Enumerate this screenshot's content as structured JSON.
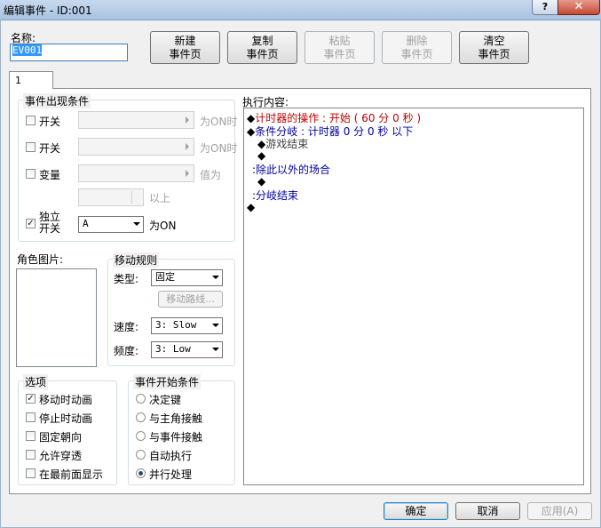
{
  "window": {
    "title": "编辑事件 - ID:001",
    "help": "?",
    "close": "✕"
  },
  "name": {
    "label": "名称:",
    "value": "EV001"
  },
  "toolbar": [
    {
      "l1": "新建",
      "l2": "事件页",
      "enabled": true
    },
    {
      "l1": "复制",
      "l2": "事件页",
      "enabled": true
    },
    {
      "l1": "粘贴",
      "l2": "事件页",
      "enabled": false
    },
    {
      "l1": "删除",
      "l2": "事件页",
      "enabled": false
    },
    {
      "l1": "清空",
      "l2": "事件页",
      "enabled": true
    }
  ],
  "tabs": [
    "1"
  ],
  "conditions": {
    "title": "事件出现条件",
    "switch1": {
      "label": "开关",
      "suffix": "为ON时"
    },
    "switch2": {
      "label": "开关",
      "suffix": "为ON时"
    },
    "variable": {
      "label": "变量",
      "suffix": "值为"
    },
    "above": "以上",
    "self_switch": {
      "label1": "独立",
      "label2": "开关",
      "value": "A",
      "suffix": "为ON",
      "checked": true
    }
  },
  "character_image": {
    "label": "角色图片:"
  },
  "movement": {
    "title": "移动规则",
    "type_label": "类型:",
    "type_value": "固定",
    "route_button": "移动路线...",
    "speed_label": "速度:",
    "speed_value": "3: Slow",
    "freq_label": "频度:",
    "freq_value": "3: Low"
  },
  "options": {
    "title": "选项",
    "items": [
      {
        "label": "移动时动画",
        "checked": true
      },
      {
        "label": "停止时动画",
        "checked": false
      },
      {
        "label": "固定朝向",
        "checked": false
      },
      {
        "label": "允许穿透",
        "checked": false
      },
      {
        "label": "在最前面显示",
        "checked": false
      }
    ]
  },
  "trigger": {
    "title": "事件开始条件",
    "items": [
      {
        "label": "决定键",
        "selected": false
      },
      {
        "label": "与主角接触",
        "selected": false
      },
      {
        "label": "与事件接触",
        "selected": false
      },
      {
        "label": "自动执行",
        "selected": false
      },
      {
        "label": "并行处理",
        "selected": true
      }
    ]
  },
  "contents": {
    "label": "执行内容:",
    "lines": [
      {
        "marker": "◆",
        "text": "计时器的操作 : 开始 ( 60 分 0 秒 )",
        "color": "#c00000"
      },
      {
        "marker": "◆",
        "text": "条件分岐 : 计时器 0 分 0 秒 以下",
        "color": "#0000a0"
      },
      {
        "marker": "◆",
        "text": "游戏结束",
        "color": "#404040"
      },
      {
        "marker": "◆",
        "text": "",
        "color": "#000000"
      },
      {
        "marker": ":",
        "text": "除此以外的场合",
        "color": "#0000a0"
      },
      {
        "marker": "◆",
        "text": "",
        "color": "#000000"
      },
      {
        "marker": ":",
        "text": "分岐结束",
        "color": "#0000a0"
      },
      {
        "marker": "◆",
        "text": "",
        "color": "#000000"
      }
    ]
  },
  "footer": {
    "ok": "确定",
    "cancel": "取消",
    "apply": "应用(A)"
  }
}
